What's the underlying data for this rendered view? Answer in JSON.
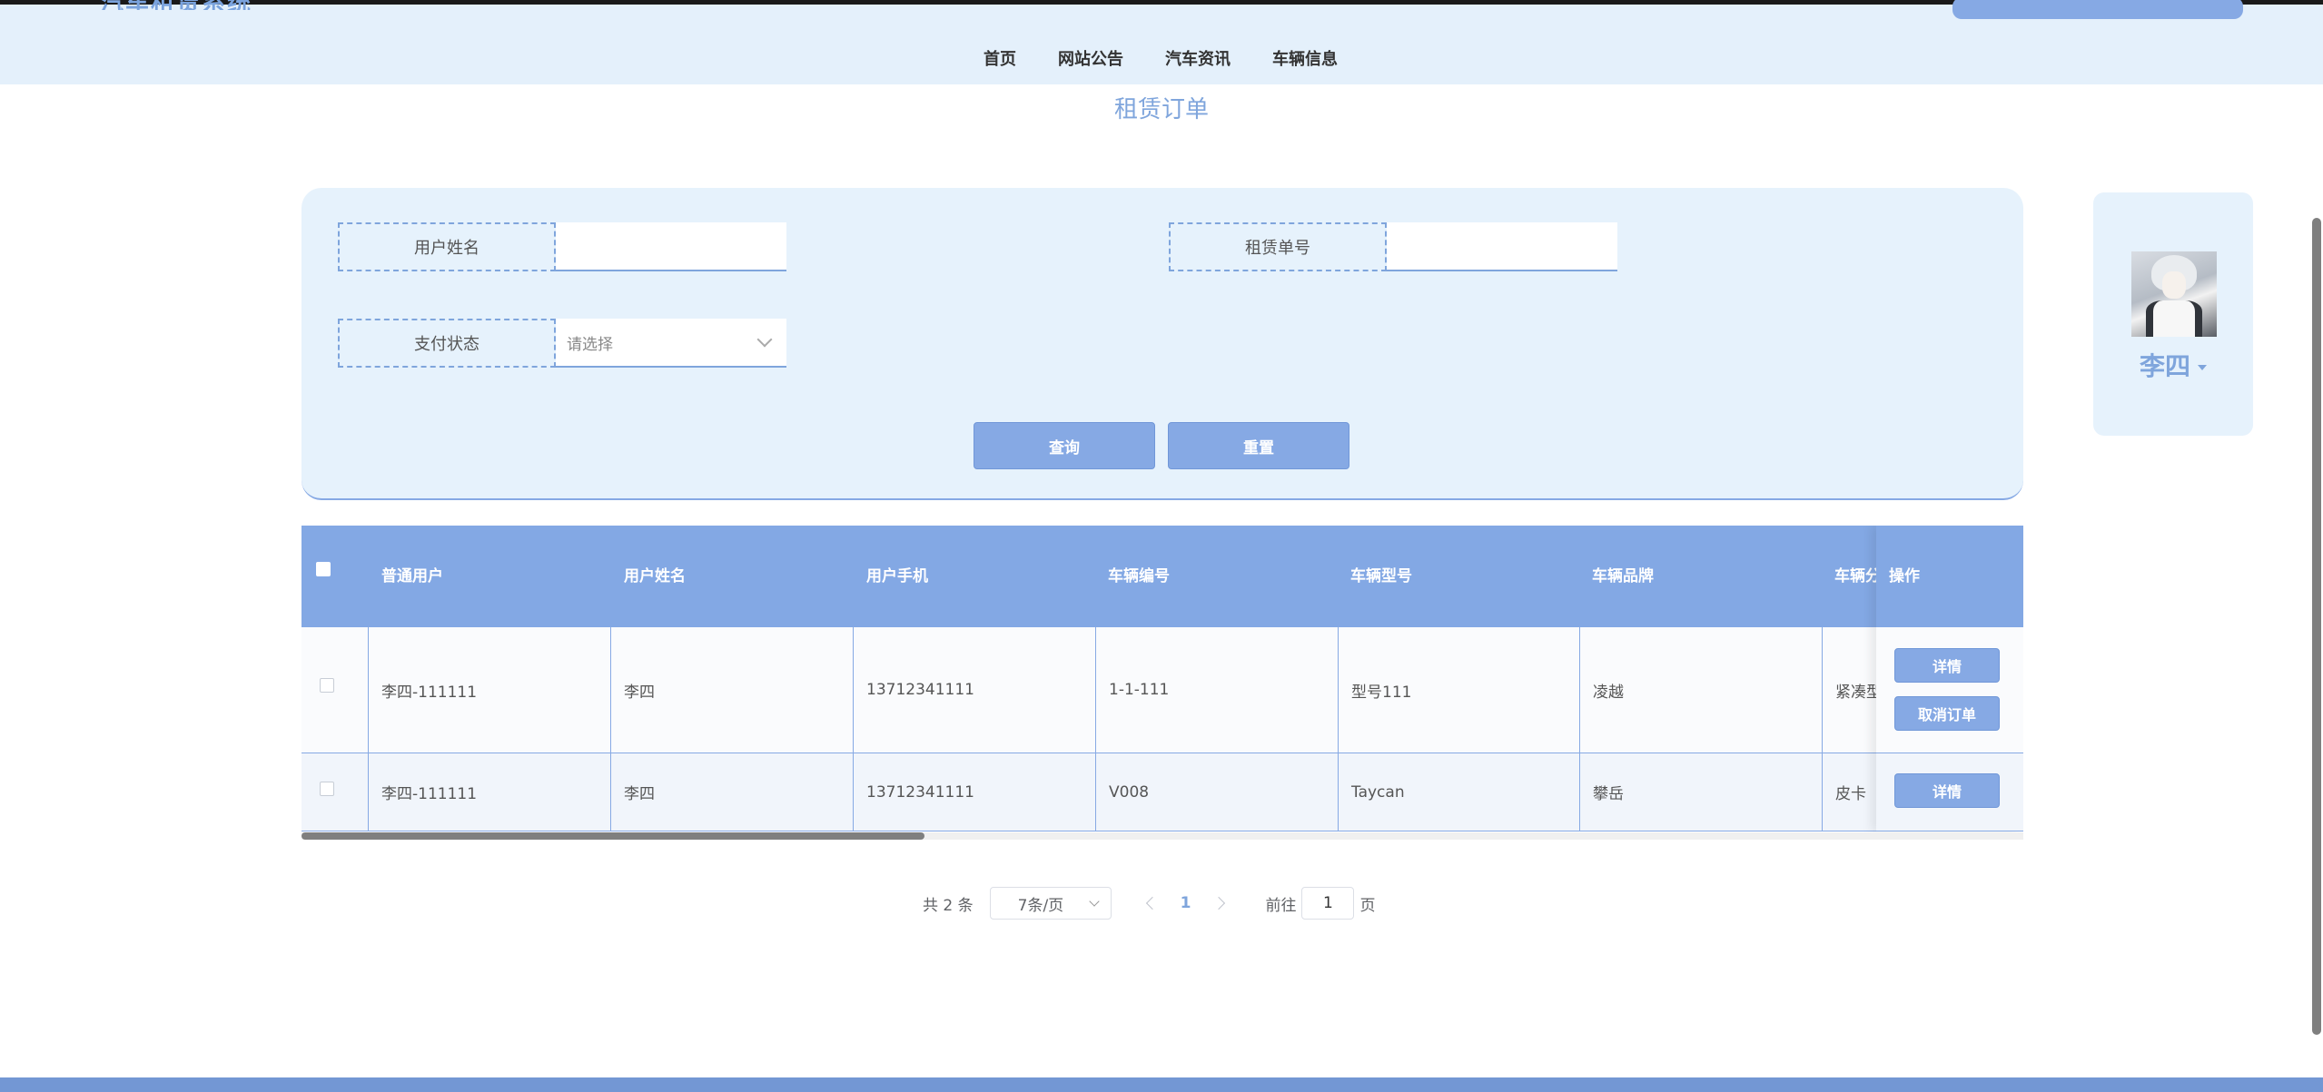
{
  "header": {
    "logo_text": "汽车租赁系统",
    "nav": [
      "首页",
      "网站公告",
      "汽车资讯",
      "车辆信息"
    ]
  },
  "page_title": "租赁订单",
  "search": {
    "user_name_label": "用户姓名",
    "user_name_value": "",
    "order_no_label": "租赁单号",
    "order_no_value": "",
    "pay_status_label": "支付状态",
    "pay_status_placeholder": "请选择",
    "query_button": "查询",
    "reset_button": "重置"
  },
  "profile": {
    "name": "李四"
  },
  "table": {
    "columns": [
      "普通用户",
      "用户姓名",
      "用户手机",
      "车辆编号",
      "车辆型号",
      "车辆品牌",
      "车辆分类",
      "操作"
    ],
    "rows": [
      {
        "user": "李四-111111",
        "name": "李四",
        "phone": "13712341111",
        "car_no": "1-1-111",
        "model": "型号111",
        "brand": "凌越",
        "category": "紧凑型",
        "actions": [
          "详情",
          "取消订单"
        ]
      },
      {
        "user": "李四-111111",
        "name": "李四",
        "phone": "13712341111",
        "car_no": "V008",
        "model": "Taycan",
        "brand": "攀岳",
        "category": "皮卡",
        "actions": [
          "详情"
        ]
      }
    ]
  },
  "pagination": {
    "total": "共 2 条",
    "page_size": "7条/页",
    "current_page": "1",
    "goto_prefix": "前往",
    "goto_value": "1",
    "goto_suffix": "页"
  }
}
